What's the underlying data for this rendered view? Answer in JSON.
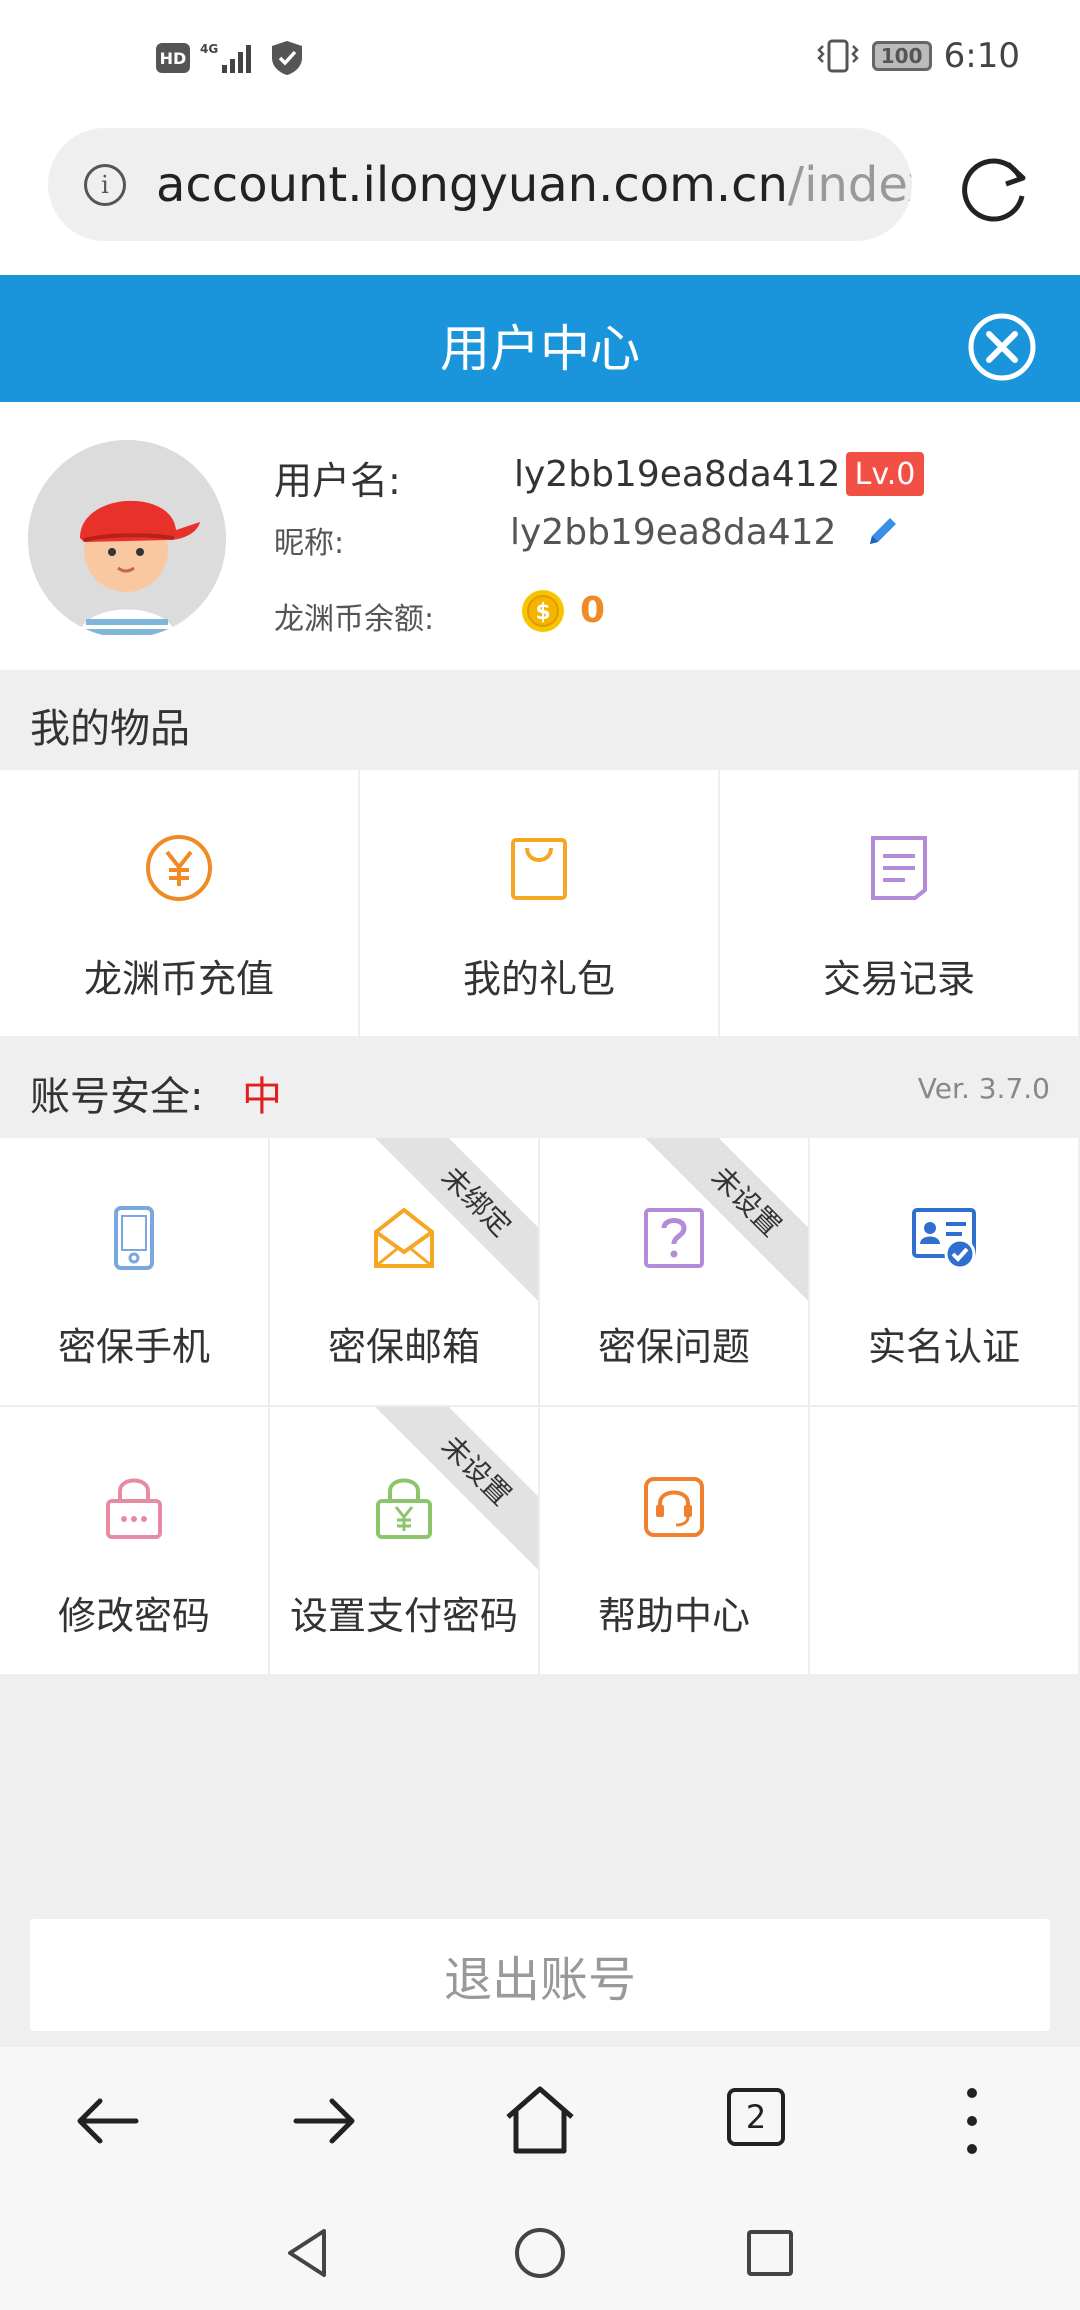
{
  "status_bar": {
    "hd": "HD",
    "network": "4G",
    "battery": "100",
    "time": "6:10"
  },
  "browser": {
    "url_main": "account.ilongyuan.com.cn",
    "url_dim": "/index.p",
    "tab_count": "2"
  },
  "header": {
    "title": "用户中心"
  },
  "profile": {
    "username_label": "用户名:",
    "username": "ly2bb19ea8da412",
    "level": "Lv.0",
    "nickname_label": "昵称:",
    "nickname": "ly2bb19ea8da412",
    "coin_label": "龙渊币余额:",
    "coin_balance": "0"
  },
  "items_section": {
    "title": "我的物品",
    "items": [
      {
        "label": "龙渊币充值",
        "icon": "yen-circle-icon",
        "color": "#f08a24"
      },
      {
        "label": "我的礼包",
        "icon": "gift-bag-icon",
        "color": "#f5a623"
      },
      {
        "label": "交易记录",
        "icon": "document-icon",
        "color": "#b38bd9"
      }
    ]
  },
  "security_section": {
    "title": "账号安全:",
    "level": "中",
    "version": "Ver. 3.7.0",
    "items": [
      {
        "label": "密保手机",
        "icon": "phone-icon",
        "ribbon": ""
      },
      {
        "label": "密保邮箱",
        "icon": "mail-icon",
        "ribbon": "未绑定"
      },
      {
        "label": "密保问题",
        "icon": "question-icon",
        "ribbon": "未设置"
      },
      {
        "label": "实名认证",
        "icon": "id-card-icon",
        "ribbon": ""
      },
      {
        "label": "修改密码",
        "icon": "lock-icon",
        "ribbon": ""
      },
      {
        "label": "设置支付密码",
        "icon": "yen-lock-icon",
        "ribbon": "未设置"
      },
      {
        "label": "帮助中心",
        "icon": "headset-icon",
        "ribbon": ""
      }
    ]
  },
  "logout_label": "退出账号",
  "colors": {
    "header_blue": "#1a95dc",
    "level_red": "#f35045",
    "coin_orange": "#f08a24"
  }
}
